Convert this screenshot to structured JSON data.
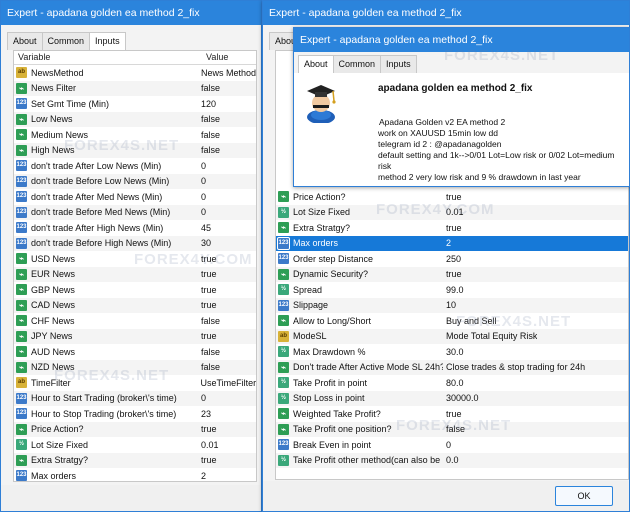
{
  "window1": {
    "title": "Expert - apadana golden ea method 2_fix",
    "tabs": [
      "About",
      "Common",
      "Inputs"
    ],
    "headers": {
      "variable": "Variable",
      "value": "Value"
    },
    "rows": [
      {
        "type": "str",
        "icon": "ab",
        "name": "NewsMethod",
        "value": "News Method"
      },
      {
        "type": "bool",
        "icon": "",
        "name": "News Filter",
        "value": "false"
      },
      {
        "type": "num",
        "icon": "123",
        "name": "Set Gmt Time (Min)",
        "value": "120"
      },
      {
        "type": "bool",
        "icon": "",
        "name": "Low News",
        "value": "false"
      },
      {
        "type": "bool",
        "icon": "",
        "name": "Medium News",
        "value": "false"
      },
      {
        "type": "bool",
        "icon": "",
        "name": "High News",
        "value": "false"
      },
      {
        "type": "num",
        "icon": "123",
        "name": "don't trade After Low News (Min)",
        "value": "0"
      },
      {
        "type": "num",
        "icon": "123",
        "name": "don't trade Before Low News (Min)",
        "value": "0"
      },
      {
        "type": "num",
        "icon": "123",
        "name": "don't trade After Med News (Min)",
        "value": "0"
      },
      {
        "type": "num",
        "icon": "123",
        "name": "don't trade Before Med News (Min)",
        "value": "0"
      },
      {
        "type": "num",
        "icon": "123",
        "name": "don't trade After High News (Min)",
        "value": "45"
      },
      {
        "type": "num",
        "icon": "123",
        "name": "don't trade Before High News (Min)",
        "value": "30"
      },
      {
        "type": "bool",
        "icon": "",
        "name": "USD News",
        "value": "true"
      },
      {
        "type": "bool",
        "icon": "",
        "name": "EUR News",
        "value": "true"
      },
      {
        "type": "bool",
        "icon": "",
        "name": "GBP News",
        "value": "true"
      },
      {
        "type": "bool",
        "icon": "",
        "name": "CAD News",
        "value": "true"
      },
      {
        "type": "bool",
        "icon": "",
        "name": "CHF News",
        "value": "false"
      },
      {
        "type": "bool",
        "icon": "",
        "name": "JPY News",
        "value": "true"
      },
      {
        "type": "bool",
        "icon": "",
        "name": "AUD News",
        "value": "false"
      },
      {
        "type": "bool",
        "icon": "",
        "name": "NZD News",
        "value": "false"
      },
      {
        "type": "str",
        "icon": "ab",
        "name": "TimeFilter",
        "value": "UseTimeFilter"
      },
      {
        "type": "num",
        "icon": "123",
        "name": "Hour to Start Trading (broker\\'s time)",
        "value": "0"
      },
      {
        "type": "num",
        "icon": "123",
        "name": "Hour to Stop Trading (broker\\'s time)",
        "value": "23"
      },
      {
        "type": "bool",
        "icon": "",
        "name": "Price Action?",
        "value": "true"
      },
      {
        "type": "dbl",
        "icon": "½",
        "name": "Lot Size Fixed",
        "value": "0.01"
      },
      {
        "type": "bool",
        "icon": "",
        "name": "Extra Stratgy?",
        "value": "true"
      },
      {
        "type": "num",
        "icon": "123",
        "name": "Max orders",
        "value": "2"
      }
    ]
  },
  "window2": {
    "title": "Expert - apadana golden ea method 2_fix",
    "rows": [
      {
        "type": "bool",
        "icon": "",
        "name": "Price Action?",
        "value": "true"
      },
      {
        "type": "dbl",
        "icon": "½",
        "name": "Lot Size Fixed",
        "value": "0.01"
      },
      {
        "type": "bool",
        "icon": "",
        "name": "Extra Stratgy?",
        "value": "true"
      },
      {
        "type": "num",
        "icon": "123",
        "name": "Max orders",
        "value": "2",
        "selected": true
      },
      {
        "type": "num",
        "icon": "123",
        "name": "Order step Distance",
        "value": "250"
      },
      {
        "type": "bool",
        "icon": "",
        "name": "Dynamic Security?",
        "value": "true"
      },
      {
        "type": "dbl",
        "icon": "½",
        "name": "Spread",
        "value": "99.0"
      },
      {
        "type": "num",
        "icon": "123",
        "name": "Slippage",
        "value": "10"
      },
      {
        "type": "bool",
        "icon": "",
        "name": "Allow to Long/Short",
        "value": "Buy and Sell"
      },
      {
        "type": "str",
        "icon": "ab",
        "name": "ModeSL",
        "value": "Mode Total Equity Risk"
      },
      {
        "type": "dbl",
        "icon": "½",
        "name": "Max Drawdown %",
        "value": "30.0"
      },
      {
        "type": "bool",
        "icon": "",
        "name": "Don't trade After Active Mode SL 24h?",
        "value": "Close trades & stop trading for 24h"
      },
      {
        "type": "dbl",
        "icon": "½",
        "name": "Take Profit in point",
        "value": "80.0"
      },
      {
        "type": "dbl",
        "icon": "½",
        "name": "Stop Loss in point",
        "value": "30000.0"
      },
      {
        "type": "bool",
        "icon": "",
        "name": "Weighted Take Profit?",
        "value": "true"
      },
      {
        "type": "bool",
        "icon": "",
        "name": "Take Profit one position?",
        "value": "false"
      },
      {
        "type": "num",
        "icon": "123",
        "name": "Break Even in point",
        "value": "0"
      },
      {
        "type": "dbl",
        "icon": "½",
        "name": "Take Profit other method(can also be zero)",
        "value": "0.0"
      }
    ],
    "ok_label": "OK"
  },
  "window3": {
    "title": "Expert - apadana golden ea method 2_fix",
    "tabs": [
      "About",
      "Common",
      "Inputs"
    ],
    "ea_name": "apadana golden ea method 2_fix",
    "description": [
      "Apadana Golden v2 EA method 2",
      "work on XAUUSD 15min low dd",
      "telegram id 2 : @apadanagolden",
      "default setting and 1k-->0/01 Lot=Low risk or 0/02 Lot=medium risk",
      "method 2 very low risk and 9 % drawdown in last year"
    ]
  },
  "watermark": "FOREX4S.NET",
  "watermark_alt": "FOREX4Y.COM",
  "colors": {
    "titlebar": "#2b84dc",
    "selection": "#1679d8"
  }
}
